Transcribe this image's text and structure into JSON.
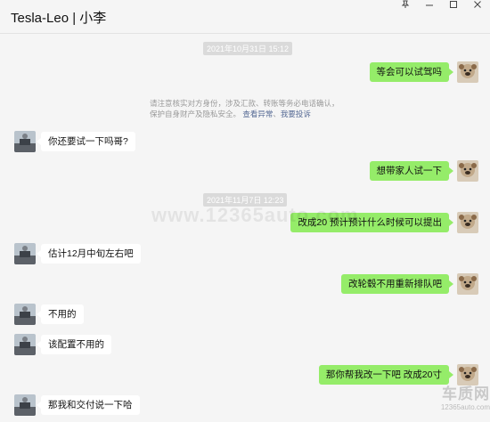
{
  "window": {
    "title": "Tesla-Leo | 小李",
    "controls": [
      "pin-icon",
      "minimize-icon",
      "maximize-icon",
      "close-icon"
    ]
  },
  "chat": {
    "timestamps": [
      "2021年10月31日 15:12",
      "2021年11月7日 12:23"
    ],
    "notice": {
      "text": "请注意核实对方身份，涉及汇款、转账等务必电话确认，保护自身财产及隐私安全。",
      "link1": "查看异常",
      "link2": "我要投诉"
    },
    "messages": [
      {
        "side": "right",
        "text": "等会可以试驾吗"
      },
      {
        "side": "left",
        "text": "你还要试一下吗哥?"
      },
      {
        "side": "right",
        "text": "想带家人试一下"
      },
      {
        "side": "right",
        "text": "改成20 预计预计什么时候可以提出"
      },
      {
        "side": "left",
        "text": "估计12月中旬左右吧"
      },
      {
        "side": "right",
        "text": "改轮毂不用重新排队吧"
      },
      {
        "side": "left",
        "text": "不用的"
      },
      {
        "side": "left",
        "text": "该配置不用的"
      },
      {
        "side": "right",
        "text": "那你帮我改一下吧 改成20寸"
      },
      {
        "side": "left",
        "text": "那我和交付说一下哈"
      }
    ]
  },
  "watermark": {
    "mid": "www.12365auto.com",
    "brand_main": "车质网",
    "brand_sub": "12365auto.com"
  },
  "colors": {
    "green_bubble": "#95ec69",
    "white_bubble": "#ffffff",
    "background": "#f5f5f5",
    "link": "#576b95"
  }
}
